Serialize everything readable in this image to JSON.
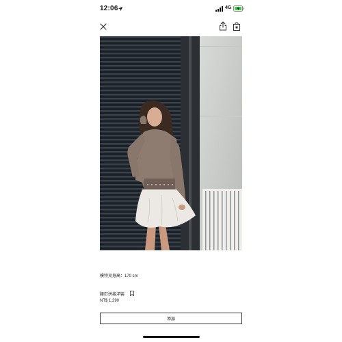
{
  "status_bar": {
    "time": "12:06",
    "network": "4G",
    "icons": [
      "location-arrow-icon",
      "signal-icon",
      "battery-charging-icon"
    ],
    "battery_color": "#3ecf4a"
  },
  "header": {
    "icons": [
      "close-icon",
      "share-icon",
      "bag-icon"
    ]
  },
  "product": {
    "image": "model-photo",
    "model_height": "模特兒身高：170 cm",
    "name": "腰釘拼接洋裝",
    "price": "NT$ 1,290",
    "add_button_label": "添加"
  },
  "colors": {
    "background": "#ffffff",
    "text": "#111111",
    "button_border": "#333333"
  }
}
